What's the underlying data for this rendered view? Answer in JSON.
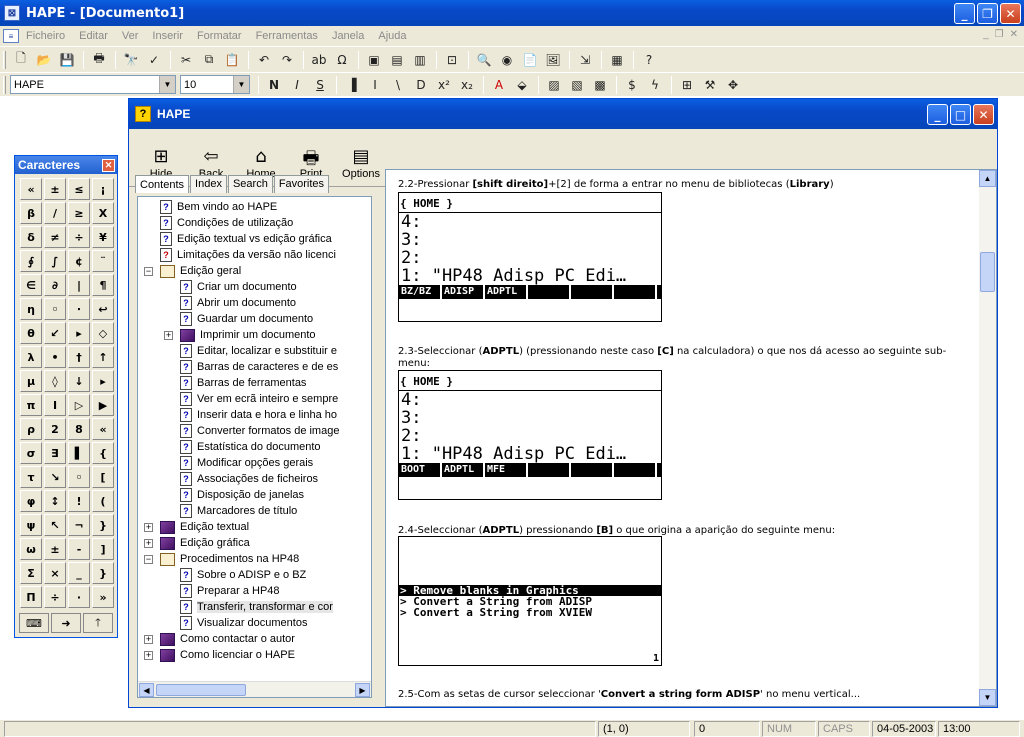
{
  "app": {
    "title": "HAPE - [Documento1]"
  },
  "menu": [
    "Ficheiro",
    "Editar",
    "Ver",
    "Inserir",
    "Formatar",
    "Ferramentas",
    "Janela",
    "Ajuda"
  ],
  "format": {
    "font": "HAPE",
    "size": "10"
  },
  "palette": {
    "title": "Caracteres",
    "glyphs": [
      "«",
      "±",
      "≤",
      "¡",
      "β",
      "/",
      "≥",
      "Χ",
      "δ",
      "≠",
      "÷",
      "¥",
      "∮",
      "∫",
      "¢",
      "¨",
      "∈",
      "∂",
      "|",
      "¶",
      "η",
      "◦",
      "∙",
      "↩",
      "θ",
      "↙",
      "▸",
      "◇",
      "λ",
      "•",
      "†",
      "↑",
      "μ",
      "◊",
      "↓",
      "▸",
      "π",
      "Ι",
      "▷",
      "▶",
      "ρ",
      "2",
      "8",
      "«",
      "σ",
      "∃",
      "▌",
      "{",
      "τ",
      "↘",
      "◦",
      "[",
      "φ",
      "↕",
      "!",
      "(",
      "ψ",
      "↖",
      "¬",
      "}",
      "ω",
      "±",
      "-",
      "]",
      "Σ",
      "×",
      "_",
      "}",
      "Π",
      "÷",
      "·",
      "»"
    ]
  },
  "help": {
    "title": "HAPE",
    "toolbar": [
      "Hide",
      "Back",
      "Home",
      "Print",
      "Options"
    ],
    "tabs": [
      "Contents",
      "Index",
      "Search",
      "Favorites"
    ],
    "tree": [
      "Bem vindo ao HAPE",
      "Condições de utilização",
      "Edição textual vs edição gráfica",
      "Limitações da versão não licenci",
      "Edição geral",
      "Criar um documento",
      "Abrir um documento",
      "Guardar um documento",
      "Imprimir um documento",
      "Editar, localizar e substituir e",
      "Barras de caracteres e de es",
      "Barras de ferramentas",
      "Ver em ecrã inteiro e sempre",
      "Inserir data e hora e linha ho",
      "Converter formatos de image",
      "Estatística do documento",
      "Modificar opções gerais",
      "Associações de ficheiros",
      "Disposição de janelas",
      "Marcadores de título",
      "Edição textual",
      "Edição gráfica",
      "Procedimentos na HP48",
      "Sobre o ADISP e o BZ",
      "Preparar a HP48",
      "Transferir, transformar e cor",
      "Visualizar documentos",
      "Como contactar o autor",
      "Como licenciar o HAPE"
    ],
    "content": {
      "step22": {
        "pre": "2.2-Pressionar ",
        "k1": "[shift direito]",
        "mid": "+[2] de forma a entrar no menu de bibliotecas (",
        "k2": "Library",
        "post": ")"
      },
      "step23": {
        "pre": "2.3-Seleccionar (",
        "k1": "ADPTL",
        "mid": ") (pressionando neste caso ",
        "k2": "[C]",
        "post": " na calculadora) o que nos dá acesso ao seguinte sub-menu:"
      },
      "step24": {
        "pre": "2.4-Seleccionar (",
        "k1": "ADPTL",
        "mid": ") pressionando ",
        "k2": "[B]",
        "post": " o que origina a aparição do seguinte menu:"
      },
      "step25": {
        "pre": "2.5-Com as setas de cursor seleccionar '",
        "k1": "Convert a string form ADISP",
        "post": "' no menu vertical..."
      },
      "screen1": {
        "header": "{ HOME }",
        "lines": [
          "4:",
          "3:",
          "2:",
          "1: \"HP48 Adisp PC Edi…"
        ],
        "softkeys": [
          "BZ/BZ",
          "ADISP",
          "ADPTL",
          "",
          "",
          ""
        ]
      },
      "screen2": {
        "header": "{ HOME }",
        "lines": [
          "4:",
          "3:",
          "2:",
          "1: \"HP48 Adisp PC Edi…"
        ],
        "softkeys": [
          "BOOT",
          "ADPTL",
          "MFE",
          "",
          "",
          ""
        ]
      },
      "screen3": {
        "rows": [
          "> Remove blanks in Graphics",
          "> Convert a String from ADISP",
          "> Convert a String from XVIEW"
        ],
        "page": "1"
      }
    }
  },
  "status": {
    "pos": "(1, 0)",
    "count": "0",
    "num": "NUM",
    "caps": "CAPS",
    "date": "04-05-2003",
    "time": "13:00"
  }
}
